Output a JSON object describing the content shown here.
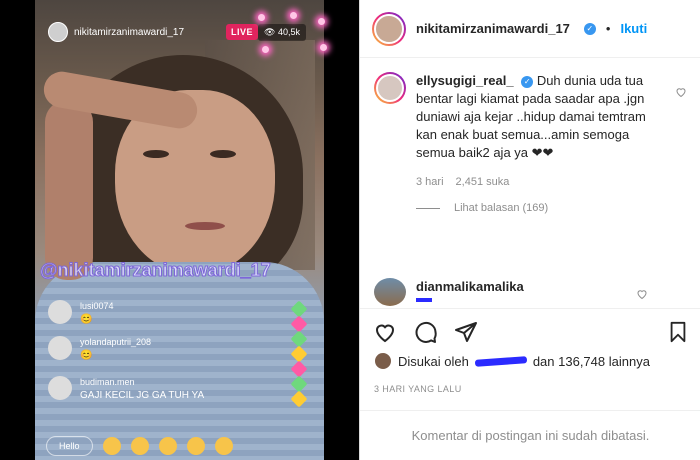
{
  "live": {
    "username": "nikitamirzanimawardi_17",
    "badge": "LIVE",
    "viewers": "40,5k",
    "watermark": "@nikitamirzanimawardi_17",
    "comments": [
      {
        "user": "lusi0074",
        "text": "😊"
      },
      {
        "user": "yolandaputrii_208",
        "text": "😊"
      },
      {
        "user": "budiman.men",
        "text": "GAJI KECIL JG GA TUH YA"
      }
    ],
    "input_placeholder": "Hello"
  },
  "post": {
    "username": "nikitamirzanimawardi_17",
    "follow_label": "Ikuti",
    "comment": {
      "user": "ellysugigi_real_",
      "text": "Duh dunia uda tua bentar lagi kiamat pada saadar apa .jgn duniawi aja kejar ..hidup damai temtram kan enak buat semua...amin semoga semua baik2 aja ya ❤❤",
      "time": "3 hari",
      "likes": "2,451 suka",
      "replies": "Lihat balasan (169)"
    },
    "second_comment_user": "dianmalikamalika",
    "liked_by_prefix": "Disukai oleh",
    "liked_by_name": "ag...",
    "liked_by_suffix": "dan 136,748 lainnya",
    "date": "3 HARI YANG LALU",
    "comments_closed": "Komentar di postingan ini sudah dibatasi."
  }
}
